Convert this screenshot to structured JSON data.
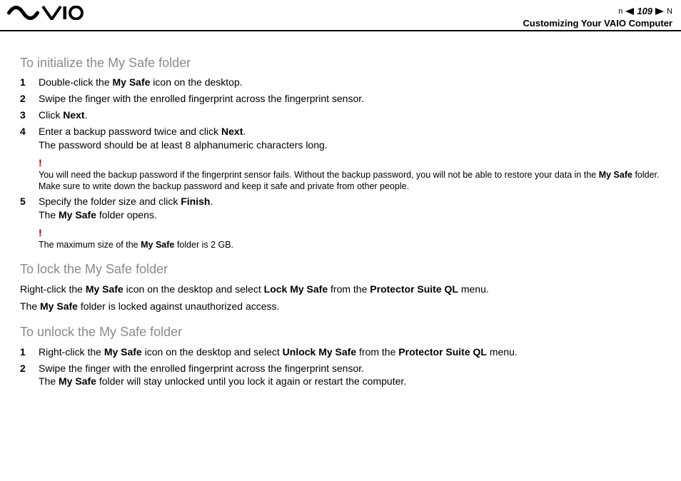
{
  "header": {
    "page_number": "109",
    "n_label": "n",
    "N_label": "N",
    "subtitle": "Customizing Your VAIO Computer"
  },
  "sections": {
    "init": {
      "title": "To initialize the My Safe folder",
      "steps": {
        "s1_a": "Double-click the ",
        "s1_b": "My Safe",
        "s1_c": " icon on the desktop.",
        "s2": "Swipe the finger with the enrolled fingerprint across the fingerprint sensor.",
        "s3_a": "Click ",
        "s3_b": "Next",
        "s3_c": ".",
        "s4_a": "Enter a backup password twice and click ",
        "s4_b": "Next",
        "s4_c": ".",
        "s4_d": "The password should be at least 8 alphanumeric characters long.",
        "s5_a": "Specify the folder size and click ",
        "s5_b": "Finish",
        "s5_c": ".",
        "s5_d": "The ",
        "s5_e": "My Safe",
        "s5_f": " folder opens."
      },
      "warn1_a": "You will need the backup password if the fingerprint sensor fails. Without the backup password, you will not be able to restore your data in the ",
      "warn1_b": "My Safe",
      "warn1_c": " folder. Make sure to write down the backup password and keep it safe and private from other people.",
      "warn2_a": "The maximum size of the ",
      "warn2_b": "My Safe",
      "warn2_c": " folder is 2 GB."
    },
    "lock": {
      "title": "To lock the My Safe folder",
      "p1_a": "Right-click the ",
      "p1_b": "My Safe",
      "p1_c": " icon on the desktop and select ",
      "p1_d": "Lock My Safe",
      "p1_e": " from the ",
      "p1_f": "Protector Suite QL",
      "p1_g": " menu.",
      "p2_a": "The ",
      "p2_b": "My Safe",
      "p2_c": " folder is locked against unauthorized access."
    },
    "unlock": {
      "title": "To unlock the My Safe folder",
      "s1_a": "Right-click the ",
      "s1_b": "My Safe",
      "s1_c": " icon on the desktop and select ",
      "s1_d": "Unlock My Safe",
      "s1_e": " from the ",
      "s1_f": "Protector Suite QL",
      "s1_g": " menu.",
      "s2_a": "Swipe the finger with the enrolled fingerprint across the fingerprint sensor.",
      "s2_b": "The ",
      "s2_c": "My Safe",
      "s2_d": " folder will stay unlocked until you lock it again or restart the computer."
    }
  },
  "nums": {
    "n1": "1",
    "n2": "2",
    "n3": "3",
    "n4": "4",
    "n5": "5"
  },
  "bang": "!"
}
